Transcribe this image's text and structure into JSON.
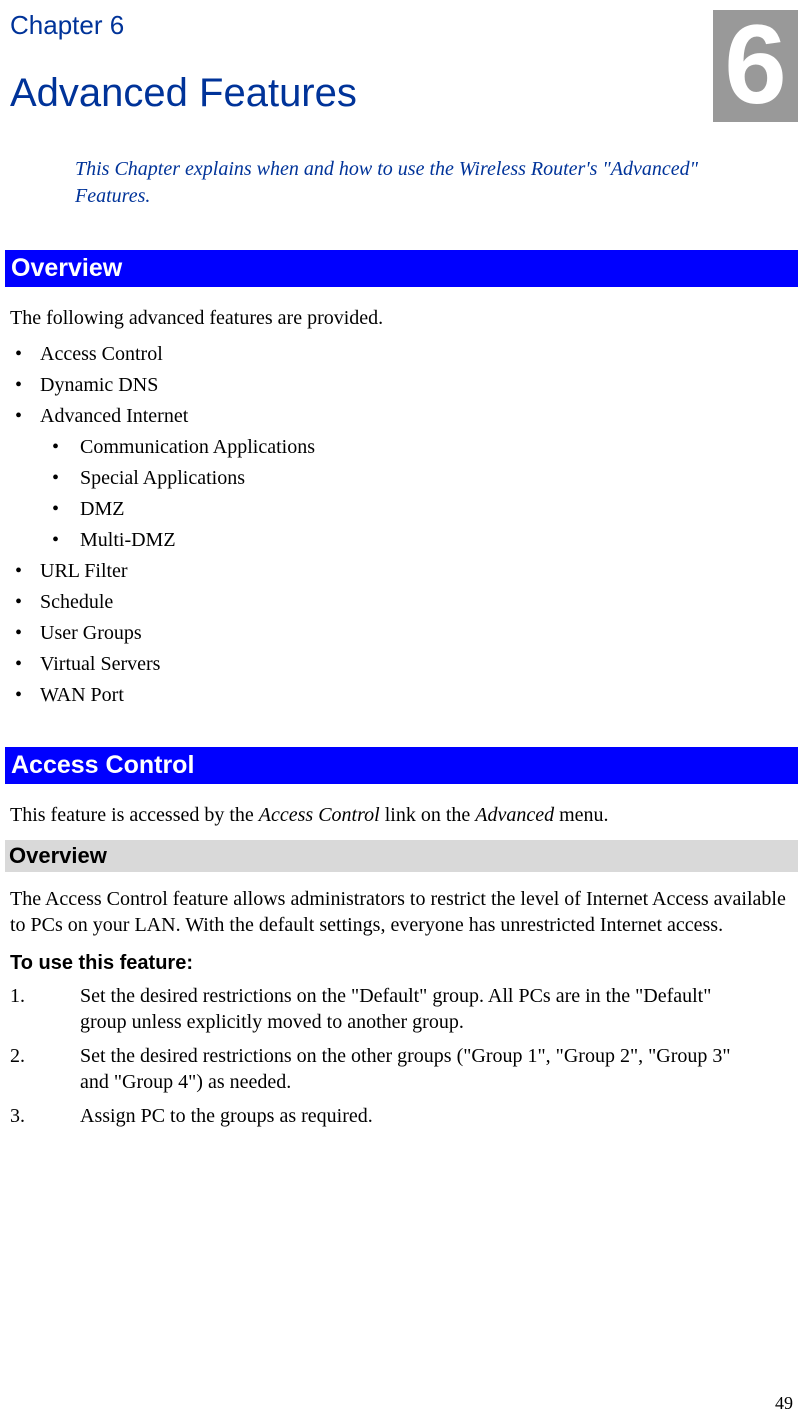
{
  "chapter": {
    "label": "Chapter 6",
    "number": "6",
    "title": "Advanced Features",
    "intro": "This Chapter explains when and how to use the Wireless Router's \"Advanced\" Features."
  },
  "sections": {
    "overview": {
      "heading": "Overview",
      "lead": "The following advanced features are provided.",
      "bullets": [
        "Access Control",
        "Dynamic DNS",
        "Advanced Internet",
        "URL Filter",
        "Schedule",
        "User Groups",
        "Virtual Servers",
        "WAN Port"
      ],
      "nested": [
        "Communication Applications",
        "Special Applications",
        "DMZ",
        "Multi-DMZ"
      ]
    },
    "access_control": {
      "heading": "Access Control",
      "lead_pre": "This feature is accessed by the ",
      "lead_italic1": "Access Control",
      "lead_mid": " link on the ",
      "lead_italic2": "Advanced",
      "lead_post": " menu.",
      "sub_overview": "Overview",
      "overview_text": "The Access Control feature allows administrators to restrict the level of Internet Access available to PCs on your LAN. With the default settings, everyone has unrestricted Internet access.",
      "to_use": "To use this feature:",
      "steps": [
        "Set the desired restrictions on the \"Default\" group. All PCs are in the \"Default\" group unless explicitly moved to another group.",
        "Set the desired restrictions on the other groups (\"Group 1\", \"Group 2\", \"Group 3\" and \"Group 4\") as needed.",
        "Assign PC to the groups as required."
      ]
    }
  },
  "page_number": "49"
}
